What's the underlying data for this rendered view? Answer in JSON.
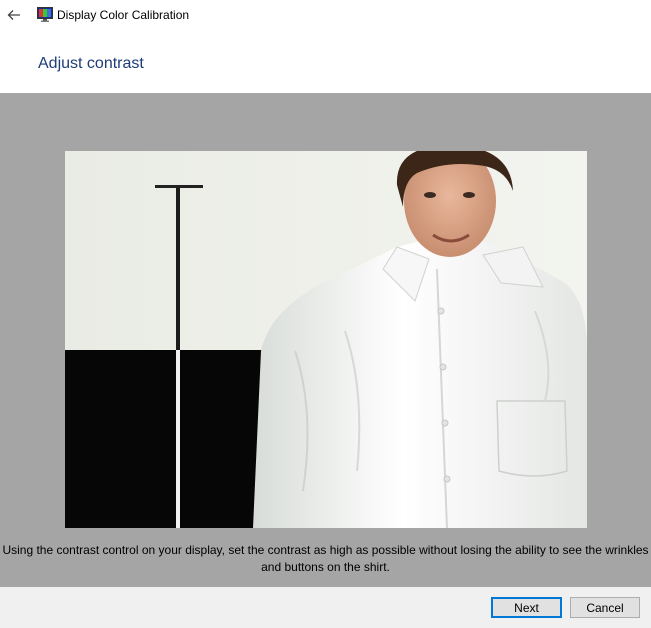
{
  "window": {
    "title": "Display Color Calibration",
    "back_icon": "arrow-left-icon",
    "app_icon": "monitor-icon"
  },
  "page": {
    "heading": "Adjust contrast",
    "instruction": "Using the contrast control on your display, set the contrast as high as possible without losing the ability to see the wrinkles and buttons on the shirt."
  },
  "footer": {
    "next_label": "Next",
    "cancel_label": "Cancel"
  },
  "colors": {
    "heading": "#1e3c78",
    "content_background": "#a5a5a5",
    "footer_background": "#f0f0f0",
    "default_button_border": "#0078d7"
  }
}
